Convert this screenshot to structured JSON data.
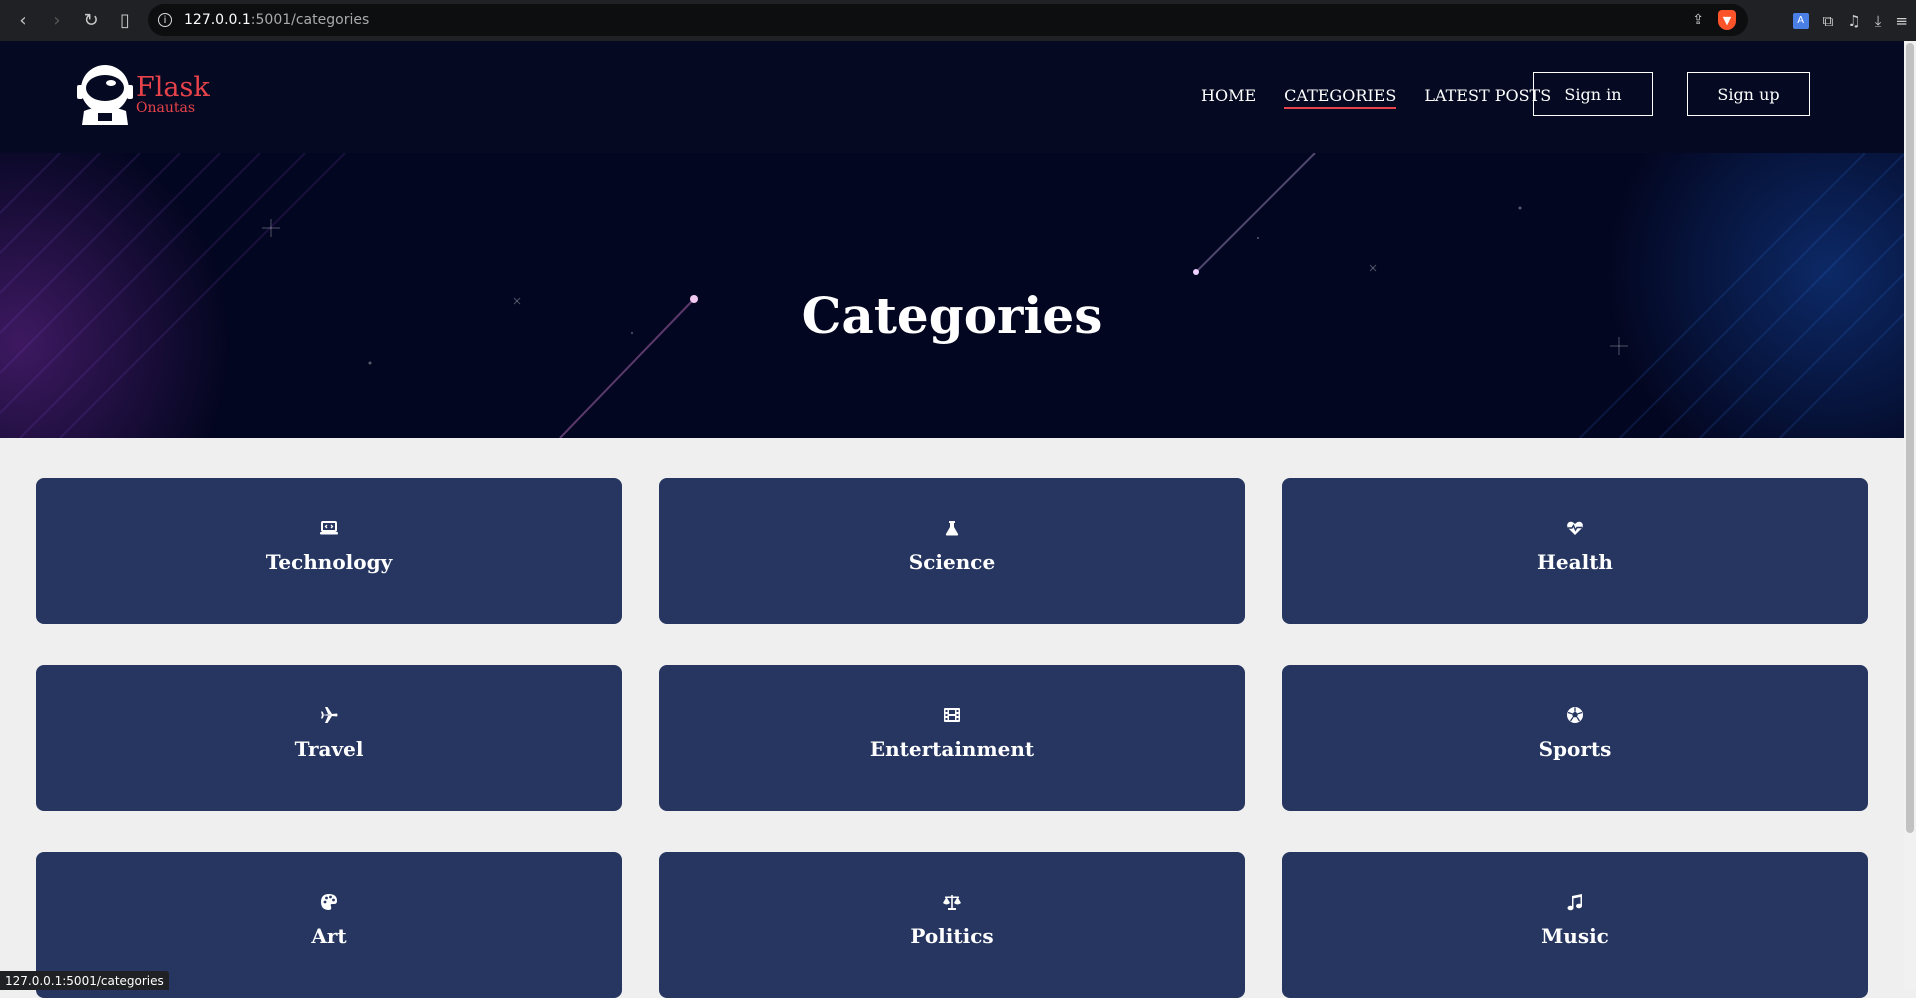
{
  "browser": {
    "url_host": "127.0.0.1",
    "url_path": ":5001/categories",
    "status_text": "127.0.0.1:5001/categories"
  },
  "site": {
    "brand": "Flask",
    "brand_sub": "Onautas",
    "nav": [
      {
        "label": "HOME",
        "active": false
      },
      {
        "label": "CATEGORIES",
        "active": true
      },
      {
        "label": "LATEST POSTS",
        "active": false
      }
    ],
    "signin_label": "Sign in",
    "signup_label": "Sign up",
    "accent_color": "#e8424a",
    "card_color": "#263660"
  },
  "hero": {
    "title": "Categories"
  },
  "categories": [
    {
      "label": "Technology",
      "icon": "laptop-code-icon"
    },
    {
      "label": "Science",
      "icon": "flask-icon"
    },
    {
      "label": "Health",
      "icon": "heart-pulse-icon"
    },
    {
      "label": "Travel",
      "icon": "plane-icon"
    },
    {
      "label": "Entertainment",
      "icon": "film-icon"
    },
    {
      "label": "Sports",
      "icon": "soccer-ball-icon"
    },
    {
      "label": "Art",
      "icon": "palette-icon"
    },
    {
      "label": "Politics",
      "icon": "scale-balance-icon"
    },
    {
      "label": "Music",
      "icon": "music-note-icon"
    }
  ]
}
